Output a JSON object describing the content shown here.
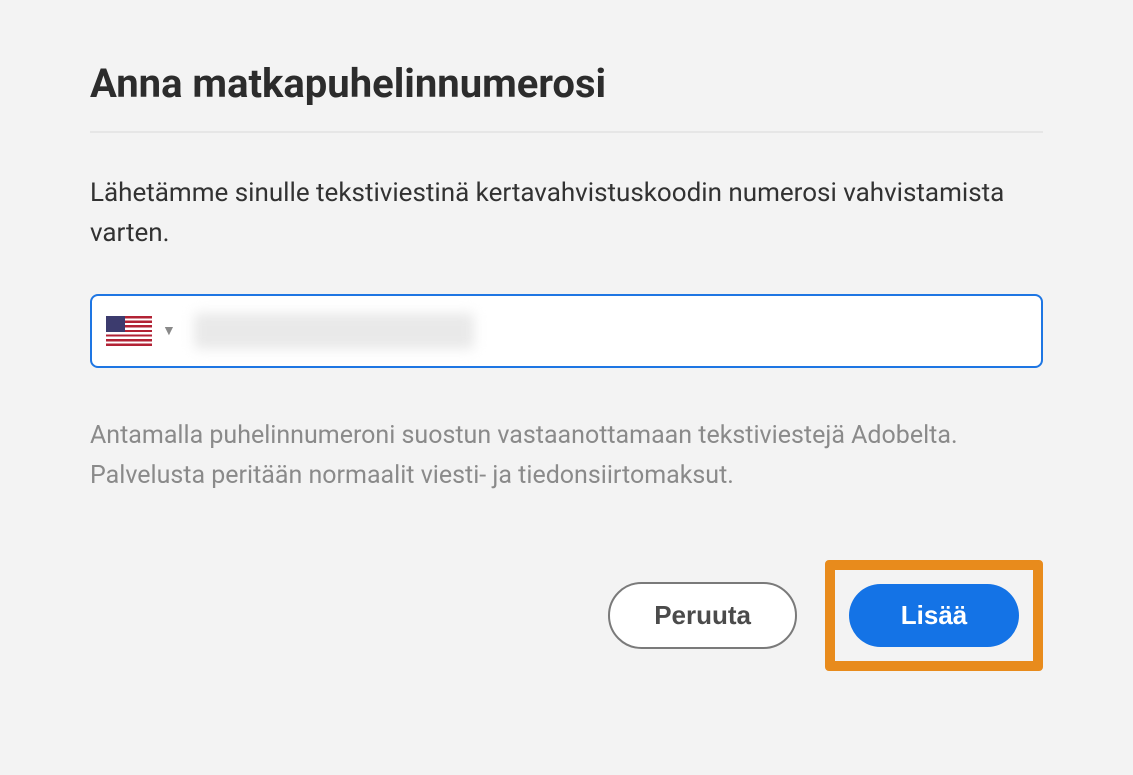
{
  "title": "Anna matkapuhelinnumerosi",
  "description": "Lähetämme sinulle tekstiviestinä kertavahvistuskoodin numerosi vahvistamista varten.",
  "phone": {
    "country_flag": "us",
    "placeholder": ""
  },
  "consent": "Antamalla puhelinnumeroni suostun vastaanottamaan tekstiviestejä Adobelta. Palvelusta peritään normaalit viesti- ja tiedonsiirtomaksut.",
  "buttons": {
    "cancel": "Peruuta",
    "add": "Lisää"
  },
  "colors": {
    "primary": "#1473e6",
    "highlight": "#e88b1c"
  }
}
